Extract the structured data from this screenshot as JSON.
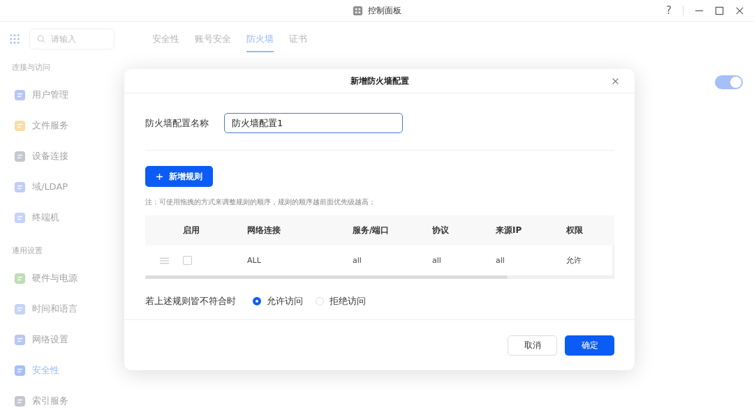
{
  "window": {
    "title": "控制面板",
    "help": "?"
  },
  "sidebar": {
    "search": {
      "placeholder": "请输入"
    },
    "groups": [
      {
        "heading": "连接与访问",
        "items": [
          {
            "label": "用户管理",
            "selected": false
          },
          {
            "label": "文件服务",
            "selected": false
          },
          {
            "label": "设备连接",
            "selected": false
          },
          {
            "label": "域/LDAP",
            "selected": false
          },
          {
            "label": "终端机",
            "selected": false
          }
        ]
      },
      {
        "heading": "通用设置",
        "items": [
          {
            "label": "硬件与电源",
            "selected": false
          },
          {
            "label": "时间和语言",
            "selected": false
          },
          {
            "label": "网络设置",
            "selected": false
          },
          {
            "label": "安全性",
            "selected": true
          },
          {
            "label": "索引服务",
            "selected": false
          }
        ]
      }
    ]
  },
  "tabs": [
    {
      "label": "安全性",
      "selected": false
    },
    {
      "label": "账号安全",
      "selected": false
    },
    {
      "label": "防火墙",
      "selected": true
    },
    {
      "label": "证书",
      "selected": false
    }
  ],
  "firewall_toggle": {
    "on": true
  },
  "dialog": {
    "title": "新增防火墙配置",
    "name_label": "防火墙配置名称",
    "name_value": "防火墙配置1",
    "add_rule_button": "新增规则",
    "note": "注：可使用拖拽的方式来调整规则的顺序，规则的顺序越前面优先级越高；",
    "table": {
      "columns": [
        "",
        "启用",
        "网络连接",
        "服务/端口",
        "协议",
        "来源IP",
        "权限"
      ],
      "rows": [
        {
          "checked": false,
          "cells": [
            "",
            "",
            "ALL",
            "all",
            "all",
            "all",
            "允许"
          ]
        }
      ]
    },
    "default_rule": {
      "label": "若上述规则皆不符合时",
      "options": [
        {
          "label": "允许访问",
          "selected": true
        },
        {
          "label": "拒绝访问",
          "selected": false
        }
      ]
    },
    "buttons": {
      "cancel": "取消",
      "ok": "确定"
    }
  }
}
